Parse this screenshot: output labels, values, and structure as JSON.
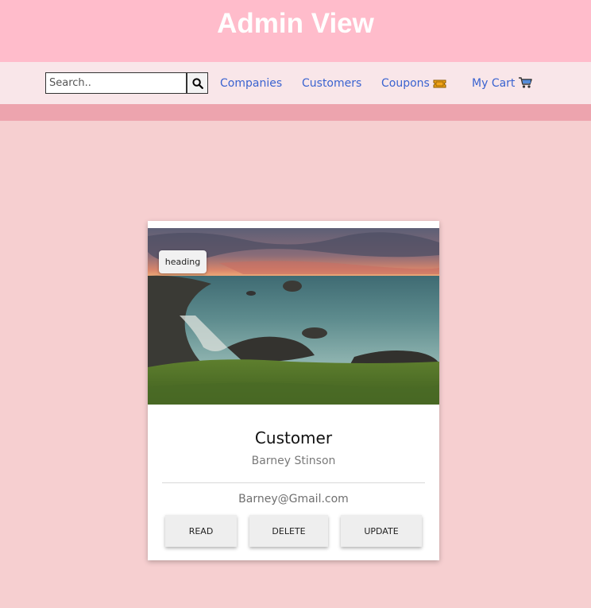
{
  "header": {
    "title": "Admin View"
  },
  "nav": {
    "search_placeholder": "Search..",
    "links": [
      {
        "label": "Companies"
      },
      {
        "label": "Customers"
      },
      {
        "label": "Coupons",
        "icon": "ticket-icon"
      },
      {
        "label": "My Cart",
        "icon": "shopping-cart-icon"
      }
    ]
  },
  "card": {
    "badge": "heading",
    "title": "Customer",
    "name": "Barney Stinson",
    "email": "Barney@Gmail.com",
    "buttons": {
      "read": "READ",
      "delete": "DELETE",
      "update": "UPDATE"
    }
  },
  "colors": {
    "header_bg": "#ffbccb",
    "nav_bg": "#f9e6e9",
    "stripe": "#eda4ae",
    "page_bg": "#f6cfd0",
    "link": "#3a63d0"
  }
}
